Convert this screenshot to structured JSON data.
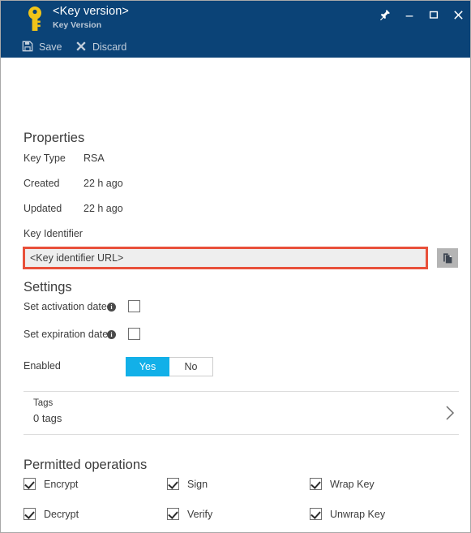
{
  "window": {
    "title": "<Key version>",
    "subtitle": "Key Version",
    "icon": "key-icon",
    "controls": [
      {
        "name": "pin-icon",
        "label": "Pin"
      },
      {
        "name": "minimize-icon",
        "label": "Minimize"
      },
      {
        "name": "maximize-icon",
        "label": "Maximize"
      },
      {
        "name": "close-icon",
        "label": "Close"
      }
    ]
  },
  "toolbar": {
    "save_label": "Save",
    "save_icon": "save-floppy-icon",
    "discard_label": "Discard",
    "discard_icon": "discard-x-icon"
  },
  "properties": {
    "heading": "Properties",
    "key_type_label": "Key Type",
    "key_type_value": "RSA",
    "created_label": "Created",
    "created_value": "22 h ago",
    "updated_label": "Updated",
    "updated_value": "22 h ago",
    "key_identifier_label": "Key Identifier",
    "key_identifier_value": "<Key identifier URL>",
    "key_identifier_placeholder": "<Key identifier URL>",
    "copy_icon": "copy-icon",
    "highlight_color": "#e8503a"
  },
  "settings": {
    "heading": "Settings",
    "activation_label": "Set activation date.",
    "activation_info_icon": "info-icon",
    "activation_checked": false,
    "expiration_label": "Set expiration date.",
    "expiration_info_icon": "info-icon",
    "expiration_checked": false,
    "enabled_label": "Enabled",
    "enabled_yes": "Yes",
    "enabled_no": "No",
    "enabled_selected": "Yes",
    "accent_color": "#12b0e8"
  },
  "tags": {
    "label": "Tags",
    "value": "0 tags",
    "chevron_icon": "chevron-right-icon"
  },
  "permitted_operations": {
    "heading": "Permitted operations",
    "items": [
      {
        "label": "Encrypt",
        "checked": true
      },
      {
        "label": "Sign",
        "checked": true
      },
      {
        "label": "Wrap Key",
        "checked": true
      },
      {
        "label": "Decrypt",
        "checked": true
      },
      {
        "label": "Verify",
        "checked": true
      },
      {
        "label": "Unwrap Key",
        "checked": true
      }
    ]
  },
  "colors": {
    "titlebar": "#0b4377",
    "key_gold": "#f0c419"
  }
}
